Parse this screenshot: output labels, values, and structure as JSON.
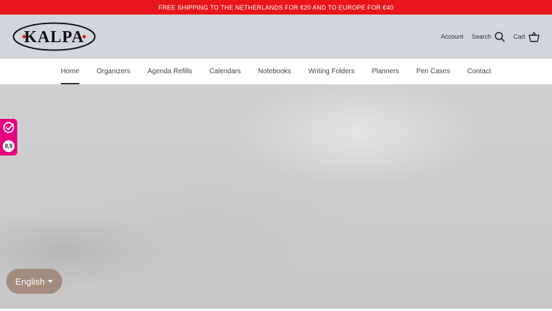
{
  "announcement": {
    "text": "FREE SHIPPING TO THE NETHERLANDS FOR €20 AND TO EUROPE FOR €40"
  },
  "header": {
    "logo_text": "KALPA",
    "account_label": "Account",
    "search_label": "Search",
    "cart_label": "Cart"
  },
  "nav": {
    "items": [
      {
        "label": "Home"
      },
      {
        "label": "Organizers"
      },
      {
        "label": "Agenda Refills"
      },
      {
        "label": "Calendars"
      },
      {
        "label": "Notebooks"
      },
      {
        "label": "Writing Folders"
      },
      {
        "label": "Planners"
      },
      {
        "label": "Pen Cases"
      },
      {
        "label": "Contact"
      }
    ],
    "active_index": 0
  },
  "review_widget": {
    "score": "8,9"
  },
  "language": {
    "selected": "English"
  },
  "colors": {
    "announcement_bg": "#e8151a",
    "header_bg": "#d2d5da",
    "review_badge": "#e5007e",
    "language_button": "#a48b7e",
    "logo_red": "#d8141a"
  }
}
